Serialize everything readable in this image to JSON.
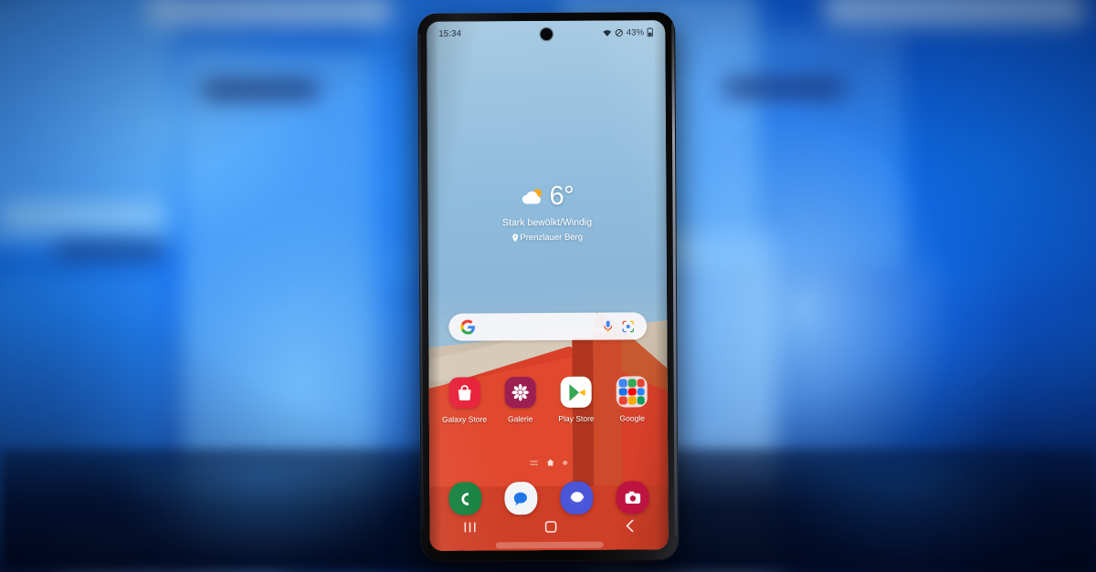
{
  "scene": {
    "description": "Samsung Galaxy smartphone standing on a dark table in front of a blurred blue studio background, showing the Android home screen",
    "background_color": "#0e5fd8",
    "table_color": "#04132f"
  },
  "phone": {
    "frame_color": "#0a0a0c",
    "screen": {
      "status_bar": {
        "time": "15:34",
        "battery_percent": "43%",
        "icons": [
          "wifi-icon",
          "mute-icon",
          "battery-icon"
        ]
      },
      "weather_widget": {
        "temperature": "6°",
        "condition": "Stark bewölkt/Windig",
        "location": "Prenzlauer Berg",
        "icon": "partly-cloudy-icon"
      },
      "search_bar": {
        "logo": "google-g-icon",
        "placeholder": "",
        "value": "",
        "mic_icon": "microphone-icon",
        "lens_icon": "google-lens-icon",
        "background": "#f7f7fa"
      },
      "app_grid": [
        {
          "label": "Galaxy Store",
          "icon": "galaxy-store-icon",
          "color": "#e8253c"
        },
        {
          "label": "Galerie",
          "icon": "gallery-icon",
          "color": "#9c1f52"
        },
        {
          "label": "Play Store",
          "icon": "play-store-icon",
          "color": "#ffffff"
        },
        {
          "label": "Google",
          "icon": "google-folder-icon",
          "color": "#eee8ea"
        }
      ],
      "page_indicator": {
        "pages": 3,
        "active_index": 1,
        "icons": [
          "list-icon",
          "home-icon",
          "dot-icon"
        ]
      },
      "dock": [
        {
          "label": "Telefon",
          "icon": "phone-icon",
          "color": "#16813f"
        },
        {
          "label": "Nachrichten",
          "icon": "messages-icon",
          "color": "#f2f4f8"
        },
        {
          "label": "Internet",
          "icon": "samsung-internet-icon",
          "color": "#4a55d8"
        },
        {
          "label": "Kamera",
          "icon": "camera-icon",
          "color": "#bd1340"
        }
      ],
      "nav_bar": [
        {
          "label": "Letzte",
          "icon": "recents-icon"
        },
        {
          "label": "Startseite",
          "icon": "home-square-icon"
        },
        {
          "label": "Zurück",
          "icon": "back-chevron-icon"
        }
      ],
      "wallpaper": {
        "name": "abstract-landscape",
        "sky_color": "#8fbcdd",
        "sand_color": "#cdbfac",
        "rock_color": "#d9402a",
        "rock_shadow_color": "#ab4a2d"
      }
    }
  }
}
